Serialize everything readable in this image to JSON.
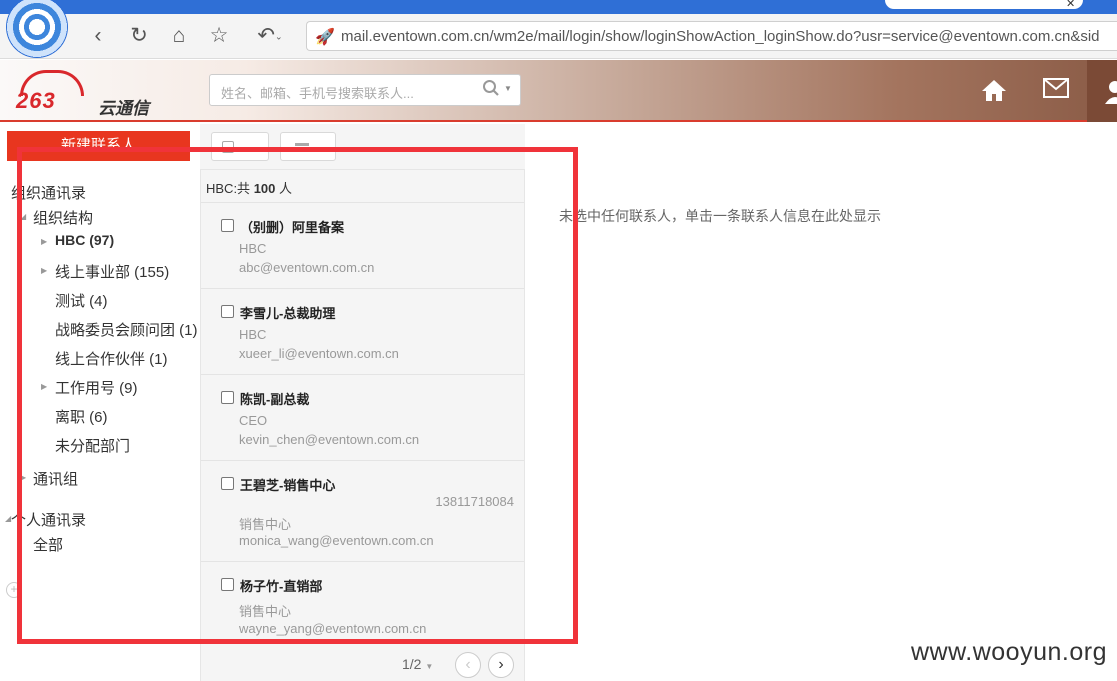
{
  "browser": {
    "address": "mail.eventown.com.cn/wm2e/mail/login/show/loginShowAction_loginShow.do?usr=service@eventown.com.cn&sid"
  },
  "header": {
    "logo_number": "263",
    "logo_text": "云通信",
    "search_placeholder": "姓名、邮箱、手机号搜索联系人..."
  },
  "sidebar": {
    "new_contact_button": "新建联系人",
    "org_directory": "组织通讯录",
    "org_structure": "组织结构",
    "departments": [
      {
        "label": "HBC (97)",
        "bold": true,
        "expandable": true
      },
      {
        "label": "线上事业部 (155)",
        "expandable": true
      },
      {
        "label": "测试 (4)",
        "expandable": false
      },
      {
        "label": "战略委员会顾问团 (1)",
        "expandable": false
      },
      {
        "label": "线上合作伙伴 (1)",
        "expandable": false
      },
      {
        "label": "工作用号 (9)",
        "expandable": true
      },
      {
        "label": "离职 (6)",
        "expandable": false
      },
      {
        "label": "未分配部门",
        "expandable": false
      }
    ],
    "groups": "通讯组",
    "personal_directory": "个人通讯录",
    "all": "全部"
  },
  "list": {
    "summary_prefix": "HBC:共",
    "summary_count": "100",
    "summary_suffix": "人",
    "contacts": [
      {
        "name": "（别删）阿里备案",
        "phone": "",
        "dept": "HBC",
        "email": "abc@eventown.com.cn"
      },
      {
        "name": "李雪儿-总裁助理",
        "phone": "",
        "dept": "HBC",
        "email": "xueer_li@eventown.com.cn"
      },
      {
        "name": "陈凯-副总裁",
        "phone": "",
        "dept": "CEO",
        "email": "kevin_chen@eventown.com.cn"
      },
      {
        "name": "王碧芝-销售中心",
        "phone": "13811718084",
        "dept": "销售中心",
        "email": "monica_wang@eventown.com.cn"
      },
      {
        "name": "杨子竹-直销部",
        "phone": "",
        "dept": "销售中心",
        "email": "wayne_yang@eventown.com.cn"
      }
    ],
    "pager": "1/2"
  },
  "detail": {
    "empty_message": "未选中任何联系人，单击一条联系人信息在此处显示"
  },
  "watermark": "www.wooyun.org",
  "colors": {
    "accent_red": "#e8361f",
    "annotation_red": "#f0333a",
    "browser_blue": "#2f6fd6"
  }
}
